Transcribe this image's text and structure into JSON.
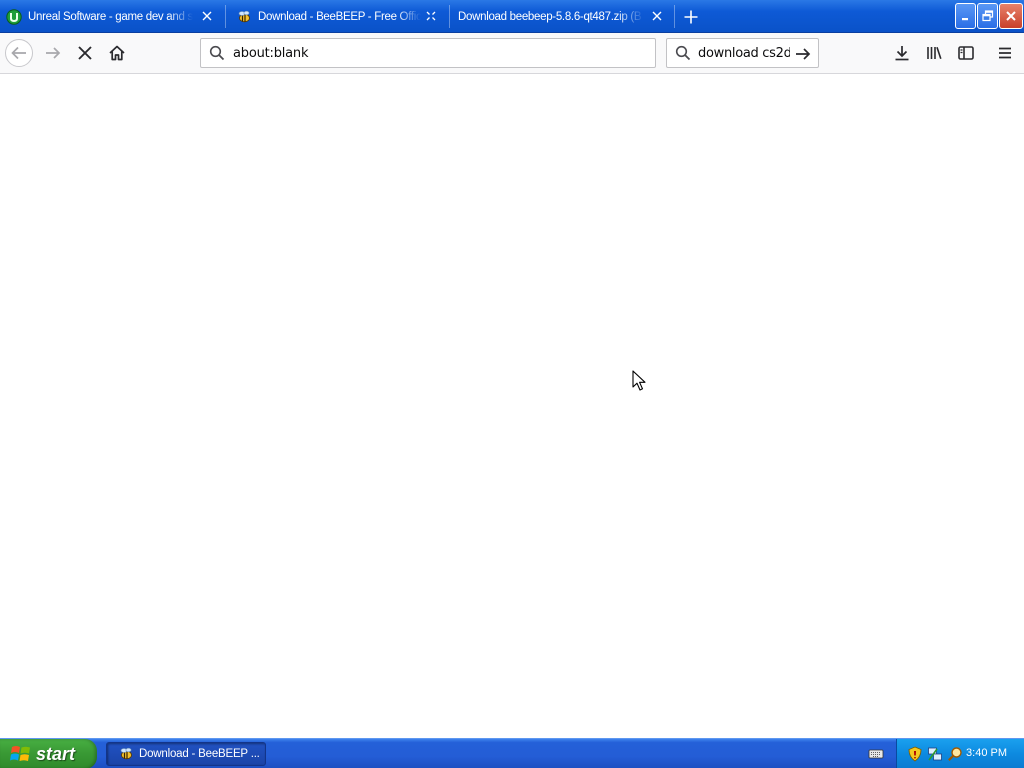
{
  "browser": {
    "tabs": [
      {
        "title": "Unreal Software - game dev and s",
        "favicon": "unreal-software-icon",
        "close_icon": "close-icon"
      },
      {
        "title": "Download - BeeBEEP - Free Office",
        "favicon": "beebeep-bee-icon",
        "close_icon": "loading-spinner-icon"
      },
      {
        "title": "Download beebeep-5.8.6-qt487.zip (B",
        "favicon": "",
        "close_icon": "close-icon"
      }
    ],
    "new_tab_icon": "plus-icon",
    "window_controls": [
      "minimize-icon",
      "restore-icon",
      "close-icon"
    ]
  },
  "toolbar": {
    "back_icon": "back-arrow-icon",
    "forward_icon": "forward-arrow-icon",
    "stop_icon": "stop-icon",
    "home_icon": "home-icon",
    "url": "about:blank",
    "search_value": "download cs2d",
    "right_icons": [
      "download-icon",
      "library-icon",
      "sidebar-icon",
      "hamburger-menu-icon"
    ]
  },
  "taskbar": {
    "start_label": "start",
    "task_item_label": "Download - BeeBEEP ...",
    "tray_icons": [
      "security-shield-icon",
      "network-icon",
      "search-magnifier-icon"
    ],
    "clock": "3:40 PM"
  },
  "colors": {
    "tabstrip": "#0e5ad6",
    "taskbar": "#245dd6",
    "start_button": "#3a9a35",
    "tray": "#0d8ae0"
  }
}
